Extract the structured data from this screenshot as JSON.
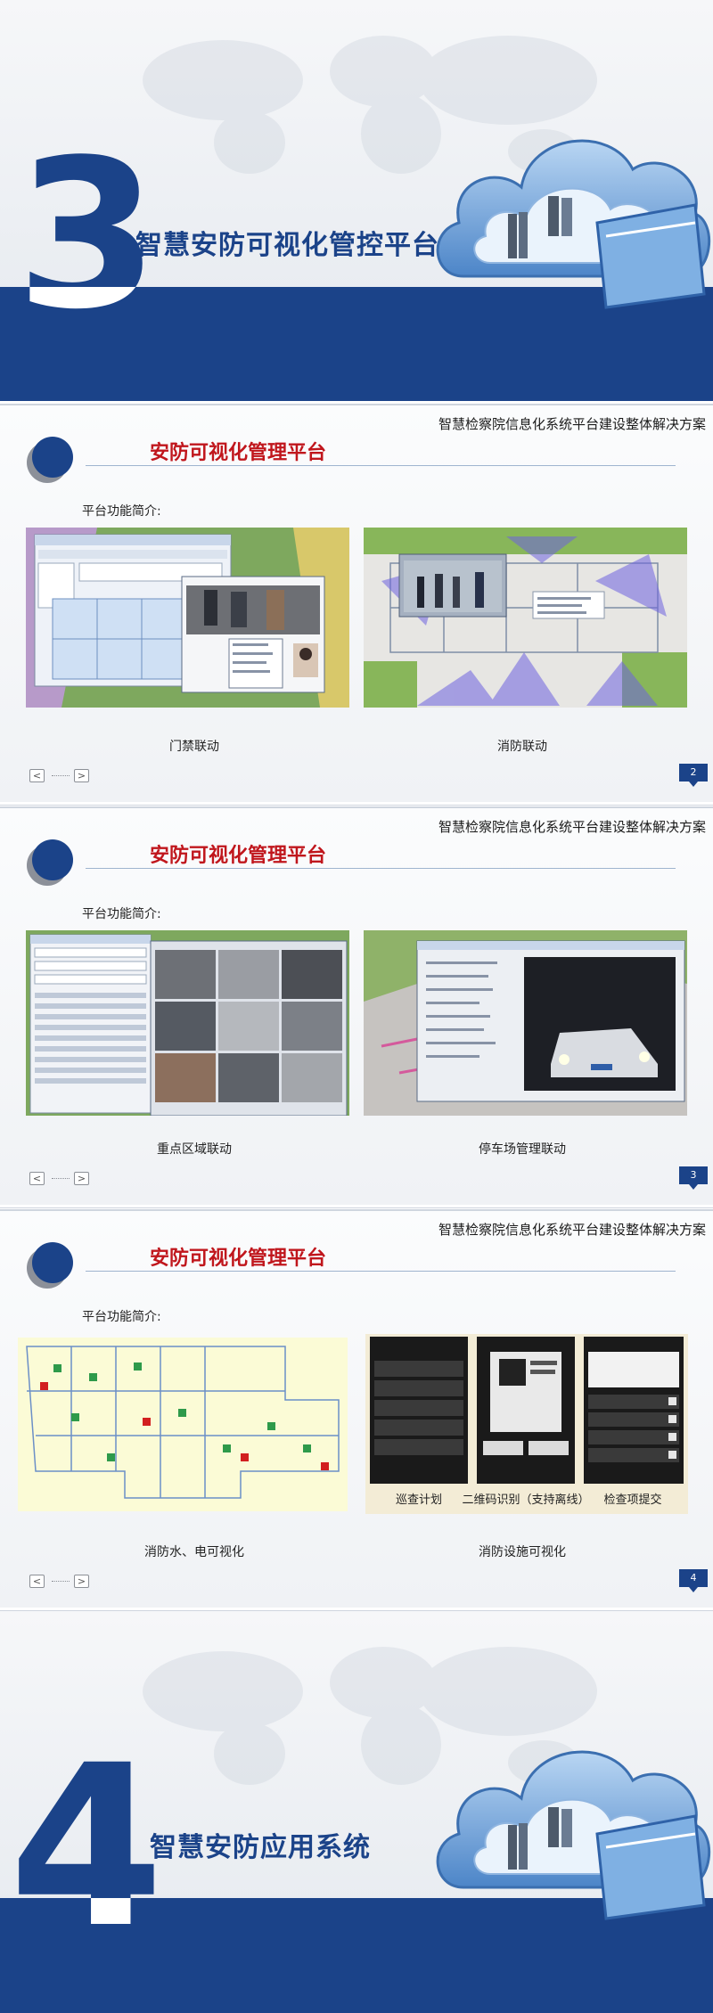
{
  "section1": {
    "number": "3",
    "title": "智慧安防可视化管控平台"
  },
  "slides": [
    {
      "subtitle": "智慧检察院信息化系统平台建设整体解决方案",
      "heading": "安防可视化管理平台",
      "intro": "平台功能简介:",
      "captions": [
        "门禁联动",
        "消防联动"
      ],
      "page": "2"
    },
    {
      "subtitle": "智慧检察院信息化系统平台建设整体解决方案",
      "heading": "安防可视化管理平台",
      "intro": "平台功能简介:",
      "captions": [
        "重点区域联动",
        "停车场管理联动"
      ],
      "page": "3"
    },
    {
      "subtitle": "智慧检察院信息化系统平台建设整体解决方案",
      "heading": "安防可视化管理平台",
      "intro": "平台功能简介:",
      "captions": [
        "消防水、电可视化",
        "消防设施可视化"
      ],
      "page": "4",
      "phone_labels": [
        "巡查计划",
        "二维码识别（支持离线）",
        "检查项提交"
      ]
    }
  ],
  "section2": {
    "number": "4",
    "title": "智慧安防应用系统"
  },
  "nav": {
    "prev": "<",
    "next": ">"
  },
  "colors": {
    "brand_blue": "#1b4389",
    "heading_red": "#c0161c",
    "map_green": "#6fa83a"
  }
}
